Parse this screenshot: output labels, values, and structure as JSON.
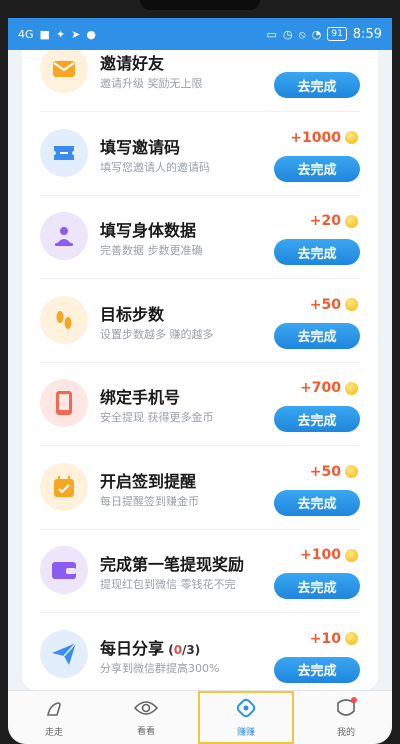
{
  "status_bar": {
    "signal": "4G",
    "battery": "91",
    "time": "8:59"
  },
  "tasks": [
    {
      "title": "邀请好友",
      "desc": "邀请升级 奖励无上限",
      "reward": "",
      "button": "去完成",
      "icon": "envelope-icon",
      "icon_bg": "#fff1dc",
      "icon_color": "#f5a623"
    },
    {
      "title": "填写邀请码",
      "desc": "填写您邀请人的邀请码",
      "reward": "+1000",
      "button": "去完成",
      "icon": "ticket-icon",
      "icon_bg": "#e3eefc",
      "icon_color": "#3b8cf0"
    },
    {
      "title": "填写身体数据",
      "desc": "完善数据 步数更准确",
      "reward": "+20",
      "button": "去完成",
      "icon": "person-scale-icon",
      "icon_bg": "#ede6fb",
      "icon_color": "#8a5cf0"
    },
    {
      "title": "目标步数",
      "desc": "设置步数越多 赚的越多",
      "reward": "+50",
      "button": "去完成",
      "icon": "footprints-icon",
      "icon_bg": "#fff1dc",
      "icon_color": "#f5a623"
    },
    {
      "title": "绑定手机号",
      "desc": "安全提现 获得更多金币",
      "reward": "+700",
      "button": "去完成",
      "icon": "phone-icon",
      "icon_bg": "#fde6e3",
      "icon_color": "#ef6a52"
    },
    {
      "title": "开启签到提醒",
      "desc": "每日提醒签到赚金币",
      "reward": "+50",
      "button": "去完成",
      "icon": "calendar-check-icon",
      "icon_bg": "#fff1dc",
      "icon_color": "#f5a623"
    },
    {
      "title": "完成第一笔提现奖励",
      "desc": "提现红包到微信 零钱花不完",
      "reward": "+100",
      "button": "去完成",
      "icon": "wallet-icon",
      "icon_bg": "#ede6fb",
      "icon_color": "#8a5cf0"
    },
    {
      "title": "每日分享",
      "progress_done": "0",
      "progress_total": "/3",
      "desc": "分享到微信群提高300%",
      "reward": "+10",
      "button": "去完成",
      "icon": "paper-plane-icon",
      "icon_bg": "#e3eefc",
      "icon_color": "#3b8cf0"
    }
  ],
  "tabbar": [
    {
      "label": "走走",
      "icon": "walk-icon",
      "active": false
    },
    {
      "label": "看看",
      "icon": "eye-icon",
      "active": false
    },
    {
      "label": "赚赚",
      "icon": "diamond-icon",
      "active": true
    },
    {
      "label": "我的",
      "icon": "profile-icon",
      "active": false,
      "badge": true
    }
  ],
  "colors": {
    "accent": "#2e90e6",
    "reward": "#f25a2f"
  }
}
